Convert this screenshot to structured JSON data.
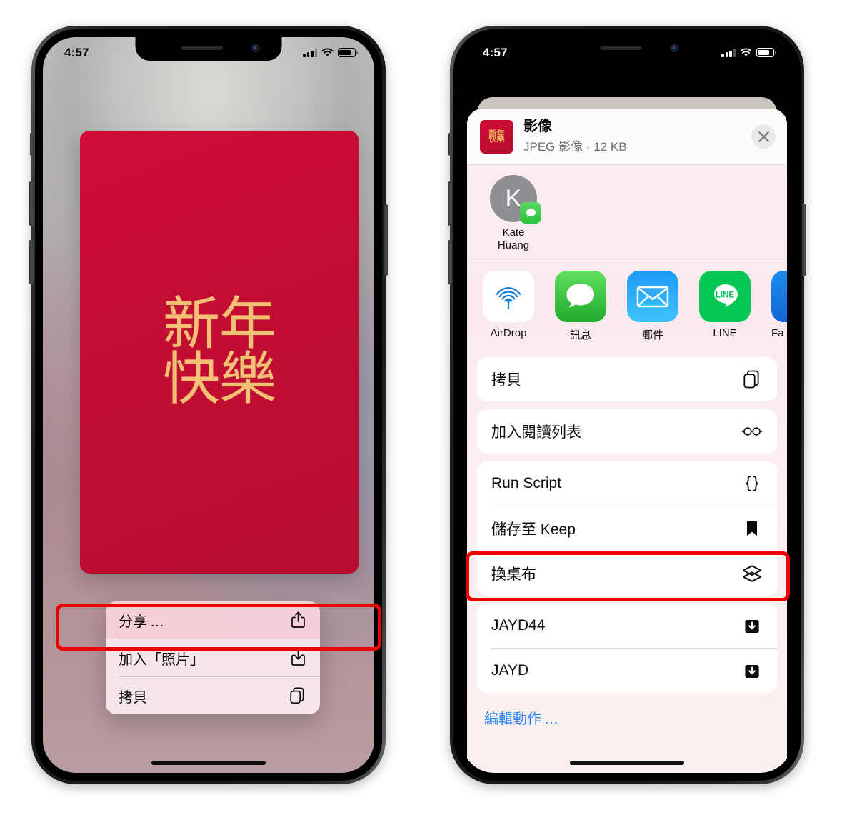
{
  "left_phone": {
    "status_bar": {
      "time": "4:57",
      "cellular_icon": "signal-bars-icon",
      "wifi_icon": "wifi-icon",
      "battery_icon": "battery-icon"
    },
    "wallpaper_card": {
      "label": "new-year-greeting-card",
      "color": "#c20d33",
      "glyph_color": "#f2c176",
      "line1": "新年",
      "line2": "快樂"
    },
    "context_menu": {
      "items": [
        {
          "label": "分享 …",
          "icon": "share-icon",
          "selected": true
        },
        {
          "label": "加入「照片」",
          "icon": "save-to-photos-icon",
          "selected": false
        },
        {
          "label": "拷貝",
          "icon": "copy-icon",
          "selected": false
        }
      ]
    },
    "highlight": {
      "target": "分享 …",
      "color": "#ef0000"
    }
  },
  "right_phone": {
    "status_bar": {
      "time": "4:57",
      "cellular_icon": "signal-bars-icon",
      "wifi_icon": "wifi-icon",
      "battery_icon": "battery-icon"
    },
    "share_sheet": {
      "header": {
        "thumbnail": "image-thumbnail",
        "title": "影像",
        "subtitle": "JPEG 影像 · 12 KB",
        "close_icon": "close-icon"
      },
      "contacts": [
        {
          "initial": "K",
          "name_line1": "Kate",
          "name_line2": "Huang",
          "badge_icon": "messages-badge-icon"
        }
      ],
      "apps": [
        {
          "name": "AirDrop",
          "icon": "airdrop-icon"
        },
        {
          "name": "訊息",
          "icon": "messages-icon"
        },
        {
          "name": "郵件",
          "icon": "mail-icon"
        },
        {
          "name": "LINE",
          "icon": "line-icon"
        },
        {
          "name": "Fa",
          "icon": "facebook-icon"
        }
      ],
      "action_groups": [
        [
          {
            "label": "拷貝",
            "icon": "copy-icon"
          }
        ],
        [
          {
            "label": "加入閱讀列表",
            "icon": "glasses-icon"
          }
        ],
        [
          {
            "label": "Run Script",
            "icon": "braces-icon"
          },
          {
            "label": "儲存至 Keep",
            "icon": "bookmark-icon"
          },
          {
            "label": "換桌布",
            "icon": "layers-icon",
            "highlighted": true
          }
        ],
        [
          {
            "label": "JAYD44",
            "icon": "download-icon"
          },
          {
            "label": "JAYD",
            "icon": "download-icon"
          }
        ]
      ],
      "edit_actions_label": "編輯動作 …"
    },
    "highlight": {
      "target": "換桌布",
      "color": "#ef0000"
    }
  }
}
